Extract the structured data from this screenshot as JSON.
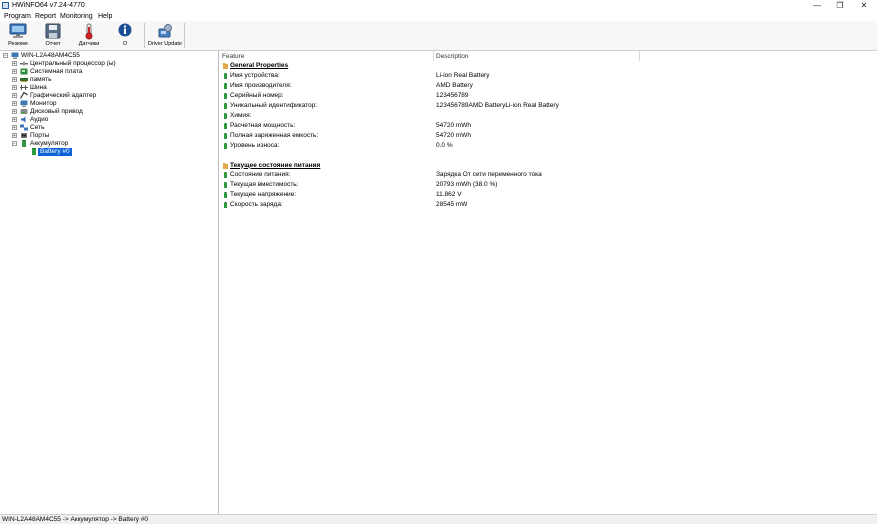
{
  "window": {
    "title": "HWiNFO64 v7.24-4770",
    "controls": [
      "—",
      "❐",
      "✕"
    ]
  },
  "menu": [
    "Program",
    "Report",
    "Monitoring",
    "Help"
  ],
  "toolbar": {
    "buttons": [
      {
        "label": "Резюме",
        "icon": "monitor-icon"
      },
      {
        "label": "Отчет",
        "icon": "save-icon"
      },
      {
        "label": "Датчики",
        "icon": "thermometer-icon"
      },
      {
        "label": "О",
        "icon": "info-icon"
      },
      {
        "label": "Driver Update",
        "icon": "driver-update-icon"
      }
    ]
  },
  "tree": {
    "root": "WIN-L2A48AM4C55",
    "items": [
      {
        "label": "Центральный процессор (ы)",
        "icon": "cpu-icon",
        "expander": "+"
      },
      {
        "label": "Системная плата",
        "icon": "motherboard-icon",
        "expander": "+"
      },
      {
        "label": "память",
        "icon": "memory-icon",
        "expander": "+"
      },
      {
        "label": "Шина",
        "icon": "bus-icon",
        "expander": "+"
      },
      {
        "label": "Графический адаптер",
        "icon": "gpu-icon",
        "expander": "+"
      },
      {
        "label": "Монитор",
        "icon": "monitor-icon",
        "expander": "+"
      },
      {
        "label": "Дисковый привод",
        "icon": "disk-icon",
        "expander": "+"
      },
      {
        "label": "Аудио",
        "icon": "audio-icon",
        "expander": "+"
      },
      {
        "label": "Сеть",
        "icon": "network-icon",
        "expander": "+"
      },
      {
        "label": "Порты",
        "icon": "ports-icon",
        "expander": "+"
      },
      {
        "label": "Аккумулятор",
        "icon": "battery-icon",
        "expander": "−"
      }
    ],
    "child": "Battery #0"
  },
  "table": {
    "headers": {
      "feature": "Feature",
      "description": "Description"
    },
    "rows": [
      {
        "type": "section",
        "feature": "General Properties",
        "description": ""
      },
      {
        "type": "item",
        "feature": "Имя устройства:",
        "description": "Li-ion Real Battery"
      },
      {
        "type": "item",
        "feature": "Имя производителя:",
        "description": "AMD Battery"
      },
      {
        "type": "item",
        "feature": "Серийный номер:",
        "description": "123456789"
      },
      {
        "type": "item",
        "feature": "Уникальный идентификатор:",
        "description": "123456789AMD BatteryLi-ion Real Battery"
      },
      {
        "type": "item",
        "feature": "Химия:",
        "description": ""
      },
      {
        "type": "item",
        "feature": "Расчетная мощность:",
        "description": "54720 mWh"
      },
      {
        "type": "item",
        "feature": "Полная заряженная емкость:",
        "description": "54720 mWh"
      },
      {
        "type": "item",
        "feature": "Уровень износа:",
        "description": "0.0 %"
      },
      {
        "type": "blank",
        "feature": "",
        "description": ""
      },
      {
        "type": "section",
        "feature": "Текущее состояние питания",
        "description": ""
      },
      {
        "type": "item",
        "feature": "Состояние питания:",
        "description": "Зарядка От сети переменного тока"
      },
      {
        "type": "item",
        "feature": "Текущая вместимость:",
        "description": "20793 mWh (38.0 %)"
      },
      {
        "type": "item",
        "feature": "Текущее напряжение:",
        "description": "11.862 V"
      },
      {
        "type": "item",
        "feature": "Скорость заряда:",
        "description": "28545 mW"
      }
    ]
  },
  "status": "WIN-L2A48AM4C55 -> Аккумулятор -> Battery #0",
  "colors": {
    "selection": "#0b63d6",
    "item_icon": "#2e9a3e",
    "section_icon": "#e2a84a"
  }
}
